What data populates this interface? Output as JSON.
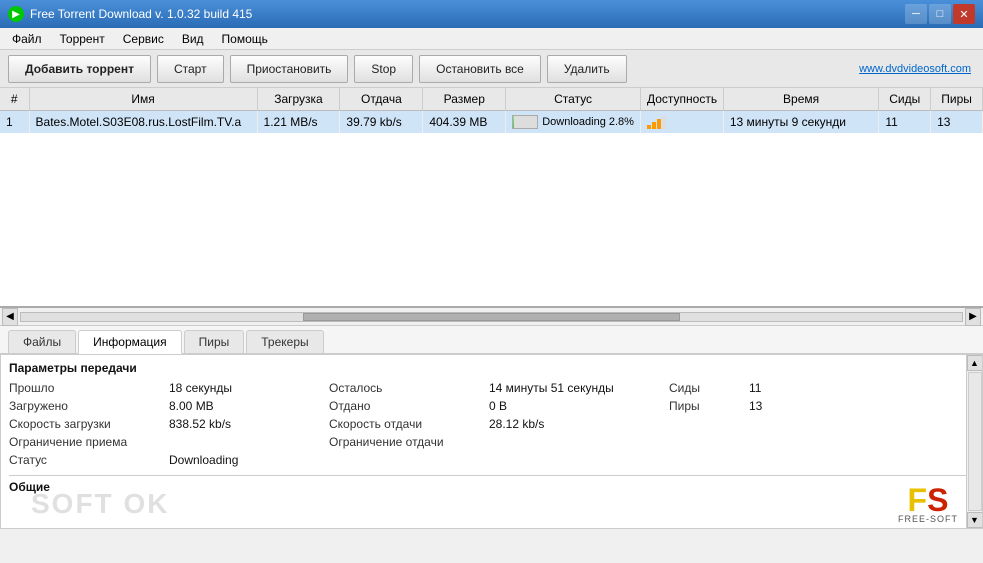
{
  "titlebar": {
    "title": "Free Torrent Download v. 1.0.32 build 415",
    "icon": "▶"
  },
  "menu": {
    "items": [
      "Файл",
      "Торрент",
      "Сервис",
      "Вид",
      "Помощь"
    ]
  },
  "toolbar": {
    "add_label": "Добавить торрент",
    "start_label": "Старт",
    "pause_label": "Приостановить",
    "stop_label": "Stop",
    "stop_all_label": "Остановить все",
    "delete_label": "Удалить",
    "dvd_link": "www.dvdvideosoft.com"
  },
  "table": {
    "columns": [
      "#",
      "Имя",
      "Загрузка",
      "Отдача",
      "Размер",
      "Статус",
      "Доступность",
      "Время",
      "Сиды",
      "Пиры"
    ],
    "rows": [
      {
        "num": "1",
        "name": "Bates.Motel.S03E08.rus.LostFilm.TV.a",
        "download": "1.21 MB/s",
        "upload": "39.79 kb/s",
        "size": "404.39 MB",
        "status": "Downloading 2.8%",
        "availability": "bars",
        "time": "13 минуты 9 секунди",
        "seeds": "11",
        "peers": "13"
      }
    ]
  },
  "tabs": {
    "items": [
      "Файлы",
      "Информация",
      "Пиры",
      "Трекеры"
    ],
    "active": 1
  },
  "info": {
    "section_title": "Параметры передачи",
    "fields": {
      "elapsed_label": "Прошло",
      "elapsed_value": "18 секунды",
      "remaining_label": "Осталось",
      "remaining_value": "14 минуты 51 секунды",
      "seeds_label": "Сиды",
      "seeds_value": "11",
      "downloaded_label": "Загружено",
      "downloaded_value": "8.00 MB",
      "uploaded_label": "Отдано",
      "uploaded_value": "0 B",
      "peers_label": "Пиры",
      "peers_value": "13",
      "dl_speed_label": "Скорость загрузки",
      "dl_speed_value": "838.52 kb/s",
      "ul_speed_label": "Скорость отдачи",
      "ul_speed_value": "28.12 kb/s",
      "dl_limit_label": "Ограничение приема",
      "dl_limit_value": "",
      "ul_limit_label": "Ограничение отдачи",
      "ul_limit_value": "",
      "status_label": "Статус",
      "status_value": "Downloading"
    }
  },
  "bottom": {
    "section_title": "Общие"
  },
  "watermark": "SOFT OK",
  "fs_logo": {
    "f": "F",
    "s": "S",
    "sub": "FREE-SOFT"
  }
}
